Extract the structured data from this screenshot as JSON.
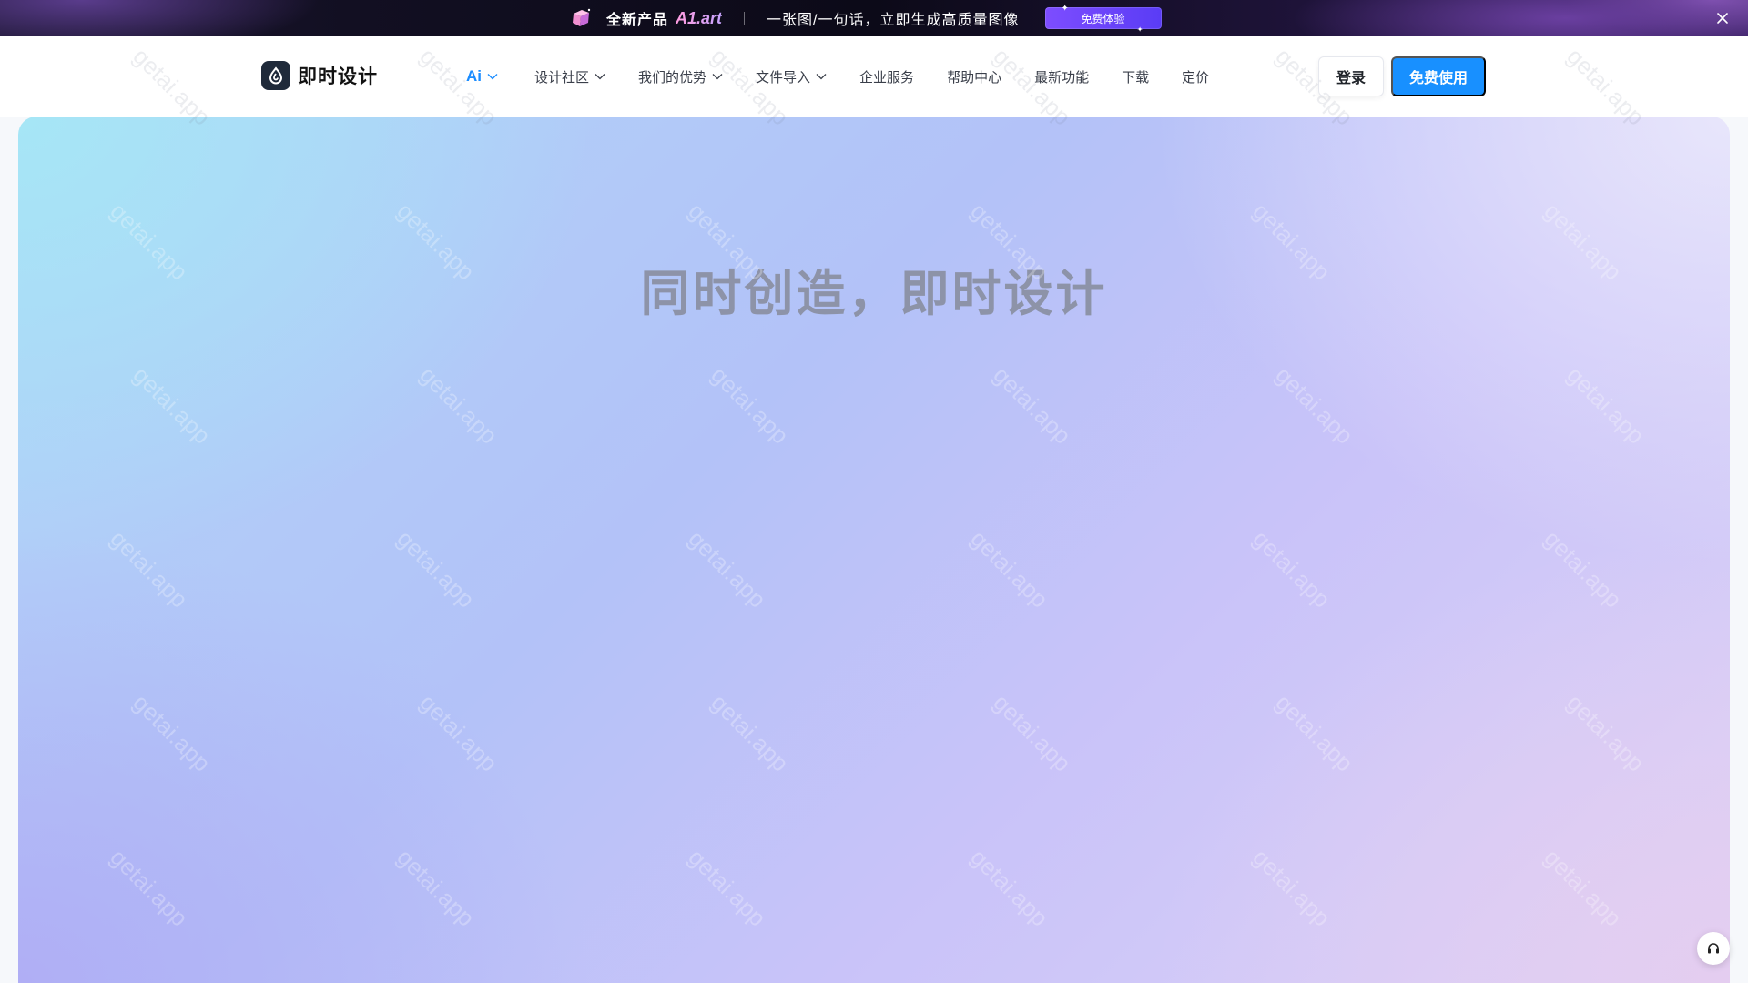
{
  "promo": {
    "label": "全新产品",
    "brand": "A1.art",
    "text": "一张图/一句话，立即生成高质量图像",
    "cta": "免费体验"
  },
  "header": {
    "logo_text": "即时设计",
    "nav": [
      {
        "label": "Ai",
        "has_dropdown": true
      },
      {
        "label": "设计社区",
        "has_dropdown": true
      },
      {
        "label": "我们的优势",
        "has_dropdown": true
      },
      {
        "label": "文件导入",
        "has_dropdown": true
      },
      {
        "label": "企业服务",
        "has_dropdown": false
      },
      {
        "label": "帮助中心",
        "has_dropdown": false
      },
      {
        "label": "最新功能",
        "has_dropdown": false
      },
      {
        "label": "下载",
        "has_dropdown": false
      },
      {
        "label": "定价",
        "has_dropdown": false
      }
    ],
    "login_label": "登录",
    "free_label": "免费使用"
  },
  "hero": {
    "title": "同时创造，即时设计"
  },
  "watermark": "getai.app",
  "colors": {
    "accent": "#1890ff",
    "ai_nav": "#1a8cff",
    "promo_cta": "#6b46ff"
  },
  "icons": {
    "promo": "cube-icon",
    "close": "close-icon",
    "logo": "drop-logo-icon",
    "dropdown": "chevron-down-icon",
    "help": "headset-icon"
  }
}
